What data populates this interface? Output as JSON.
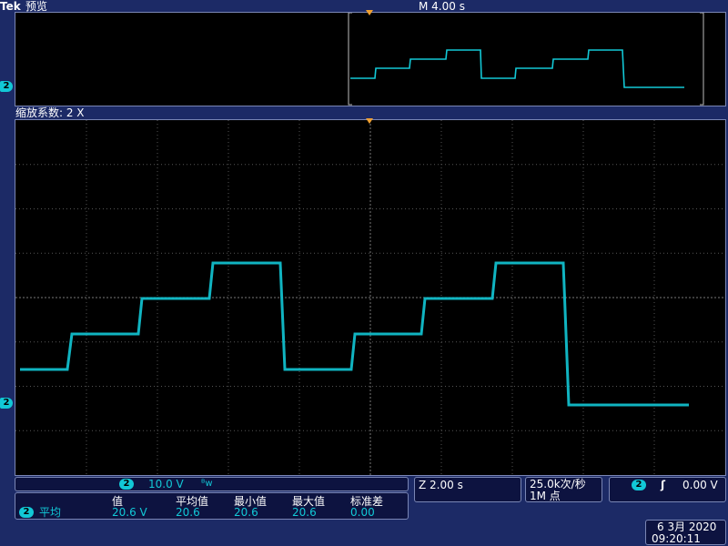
{
  "header": {
    "brand": "Tek",
    "mode": "预览",
    "timebase": "M 4.00 s"
  },
  "zoom": {
    "label": "缩放系数: 2 X"
  },
  "channel": {
    "number": "2",
    "color": "#12c8d6"
  },
  "status": {
    "ch_scale": "10.0 V",
    "bw_symbol": "ᴮw",
    "zoom_time": "Z 2.00 s",
    "sample_rate": "25.0k次/秒",
    "record_length": "1M 点",
    "trigger_slope": "ʃ",
    "trigger_level": "0.00 V"
  },
  "measurement": {
    "name": "平均",
    "headers": [
      "值",
      "平均值",
      "最小值",
      "最大值",
      "标准差"
    ],
    "values": [
      "20.6 V",
      "20.6",
      "20.6",
      "20.6",
      "0.00"
    ]
  },
  "datetime": {
    "date": "6 3月 2020",
    "time": "09:20:11"
  }
}
